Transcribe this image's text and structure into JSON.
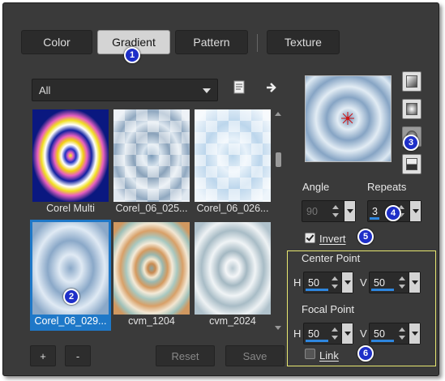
{
  "tabs": [
    {
      "label": "Color",
      "active": false
    },
    {
      "label": "Gradient",
      "active": true
    },
    {
      "label": "Pattern",
      "active": false
    },
    {
      "label": "Texture",
      "active": false
    }
  ],
  "badges": [
    "1",
    "2",
    "3",
    "4",
    "5",
    "6"
  ],
  "gallery": {
    "category": "All",
    "items": [
      {
        "label": "Corel Multi",
        "selected": false
      },
      {
        "label": "Corel_06_025...",
        "selected": false
      },
      {
        "label": "Corel_06_026...",
        "selected": false
      },
      {
        "label": "Corel_06_029...",
        "selected": true
      },
      {
        "label": "cvm_1204",
        "selected": false
      },
      {
        "label": "cvm_2024",
        "selected": false
      }
    ]
  },
  "buttons": {
    "add": "+",
    "remove": "-",
    "reset": "Reset",
    "save": "Save"
  },
  "controls": {
    "angle_label": "Angle",
    "angle_value": "90",
    "repeats_label": "Repeats",
    "repeats_value": "3",
    "invert_label": "Invert",
    "invert_checked": true,
    "center_point_label": "Center Point",
    "center_h_label": "H",
    "center_h": "50",
    "center_v_label": "V",
    "center_v": "50",
    "focal_point_label": "Focal Point",
    "focal_h_label": "H",
    "focal_h": "50",
    "focal_v_label": "V",
    "focal_v": "50",
    "link_label": "Link",
    "link_checked": false
  },
  "colors": {
    "accent": "#1e78c8",
    "badge": "#1e2fc8",
    "highlight_box": "#e8e870"
  }
}
